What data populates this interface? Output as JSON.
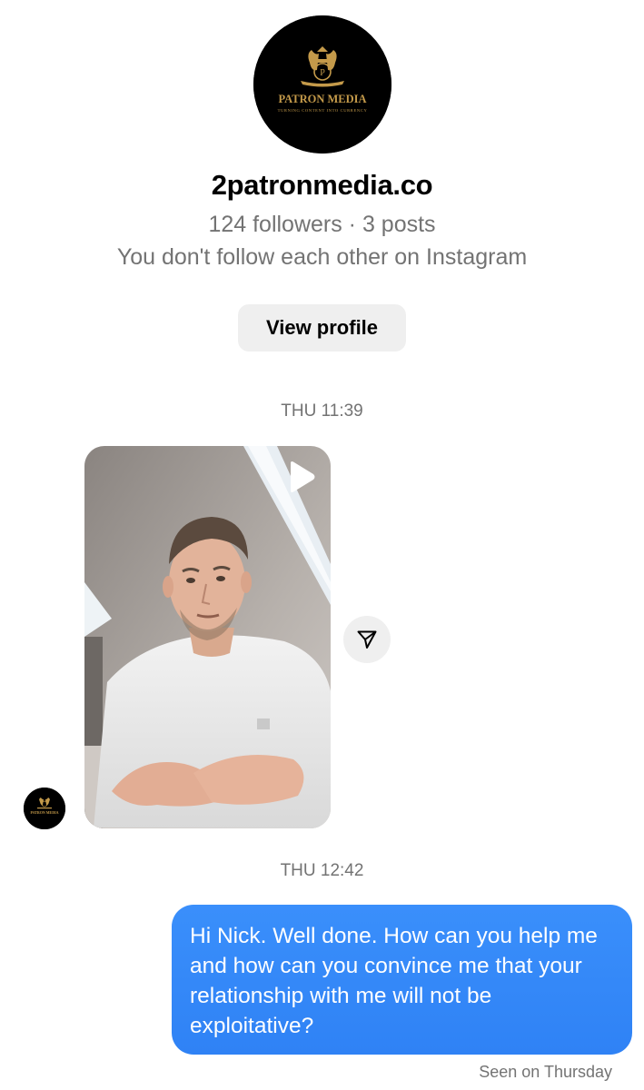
{
  "profile": {
    "logo_text": "PATRON MEDIA",
    "logo_tagline": "TURNING CONTENT INTO CURRENCY",
    "username": "2patronmedia.co",
    "stats": "124 followers · 3 posts",
    "follow_note": "You don't follow each other on Instagram",
    "view_profile_label": "View profile"
  },
  "messages": {
    "timestamp_1": "THU 11:39",
    "timestamp_2": "THU 12:42",
    "outgoing_text": "Hi Nick. Well done. How can you help me and how can you convince me that your relationship with me will not be exploitative?",
    "seen_status": "Seen on Thursday"
  },
  "icons": {
    "play": "play-icon",
    "share": "paper-plane-icon",
    "logo": "crest-logo-icon"
  },
  "colors": {
    "bubble": "#3797f0",
    "secondary_text": "#737373",
    "button_bg": "#efefef",
    "logo_gold": "#c49a4a"
  }
}
